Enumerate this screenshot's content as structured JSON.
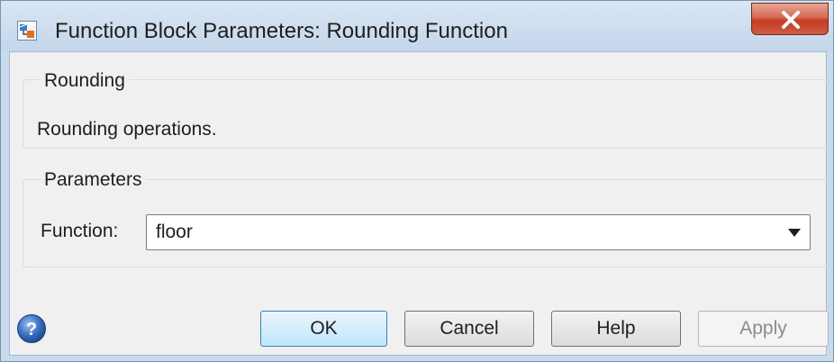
{
  "window": {
    "title": "Function Block Parameters: Rounding Function",
    "close_icon": "close-icon",
    "app_icon": "simulink-block-icon"
  },
  "description_group": {
    "legend": "Rounding",
    "text": "Rounding operations."
  },
  "parameters_group": {
    "legend": "Parameters",
    "function_label": "Function:",
    "function_value": "floor"
  },
  "buttons": {
    "ok": "OK",
    "cancel": "Cancel",
    "help": "Help",
    "apply": "Apply",
    "apply_enabled": false
  },
  "colors": {
    "ok_accent": "#bee6fd",
    "close_button": "#c43b22"
  }
}
